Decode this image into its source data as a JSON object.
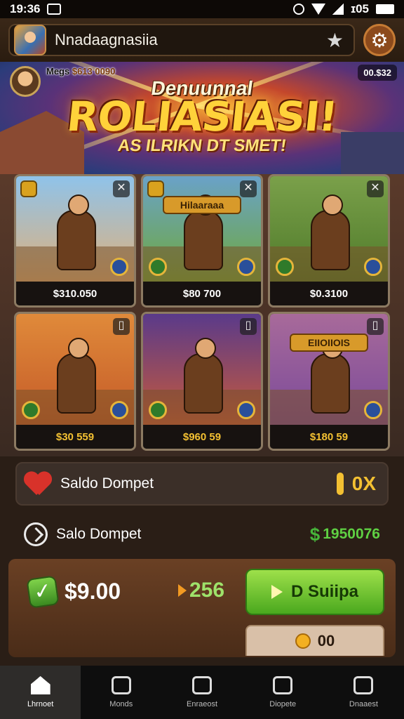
{
  "status_bar": {
    "time": "19:36",
    "right_text": "ɪ05"
  },
  "header": {
    "title": "Nnadaagnasiia",
    "icons": [
      "app-avatar",
      "star-icon",
      "gear-icon"
    ]
  },
  "banner": {
    "left_tag_prefix": "Megs ",
    "left_tag_value": "$613 0090",
    "right_tag": "00.$32",
    "subtitle": "Denuunnal",
    "title": "ROLIASIASI!",
    "tagline": "AS ILRIKN DT SMET!"
  },
  "cards": [
    {
      "price": "$310.050",
      "price_color": "#ffffff",
      "title": "",
      "art": [
        "#8fc3ea",
        "#e0b07a"
      ]
    },
    {
      "price": "$80 700",
      "price_color": "#ffffff",
      "title": "Hilaaraaa",
      "art": [
        "#6aa2c8",
        "#6fa83a"
      ]
    },
    {
      "price": "$0.3100",
      "price_color": "#ffffff",
      "title": "",
      "art": [
        "#7aa04a",
        "#4f7a2a"
      ]
    },
    {
      "price": "$30 559",
      "price_color": "#f3c032",
      "title": "",
      "art": [
        "#e08a3a",
        "#c45a28"
      ]
    },
    {
      "price": "$960 59",
      "price_color": "#f3c032",
      "title": "",
      "art": [
        "#5a3a8a",
        "#c85a3a"
      ]
    },
    {
      "price": "$180 59",
      "price_color": "#f3c032",
      "title": "EIIOIIOIS",
      "art": [
        "#a86a9a",
        "#7a4a9a"
      ]
    }
  ],
  "favorite_row": {
    "label": "Saldo Dompet",
    "value": "0X"
  },
  "wallet_row": {
    "label": "Salo Dompet",
    "value": "1950076",
    "cash_symbol": "$"
  },
  "purchase": {
    "check": "✓",
    "price": "$9.00",
    "count": "256",
    "buy_label": "D Suiipa",
    "gem_label": "00"
  },
  "nav": {
    "items": [
      {
        "label": "Lhrnoet",
        "active": true
      },
      {
        "label": "Monds",
        "active": false
      },
      {
        "label": "Enraeost",
        "active": false
      },
      {
        "label": "Diopete",
        "active": false
      },
      {
        "label": "Dnaaest",
        "active": false
      }
    ]
  },
  "colors": {
    "accent_green": "#5fd043",
    "accent_gold": "#f3c032",
    "panel_brown": "#4a2c18"
  }
}
